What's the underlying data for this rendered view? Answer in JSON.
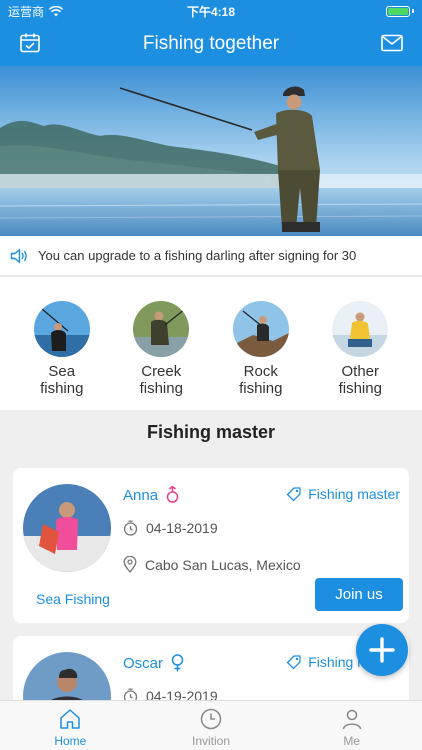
{
  "status": {
    "carrier": "运营商",
    "time": "下午4:18"
  },
  "header": {
    "title": "Fishing together",
    "left_icon": "calendar-icon",
    "right_icon": "mail-icon"
  },
  "notice": {
    "icon": "speaker-icon",
    "text": "You can upgrade to a fishing darling after signing for 30"
  },
  "categories": [
    {
      "label": "Sea fishing"
    },
    {
      "label": "Creek fishing"
    },
    {
      "label": "Rock fishing"
    },
    {
      "label": "Other fishing"
    }
  ],
  "section": {
    "title": "Fishing master"
  },
  "masters": [
    {
      "name": "Anna",
      "gender": "female",
      "tag": "Fishing master",
      "date": "04-18-2019",
      "location": "Cabo San Lucas, Mexico",
      "type": "Sea Fishing",
      "join_label": "Join us"
    },
    {
      "name": "Oscar",
      "gender": "female",
      "tag": "Fishing master",
      "date": "04-19-2019"
    }
  ],
  "tabs": [
    {
      "label": "Home",
      "active": true
    },
    {
      "label": "Invition",
      "active": false
    },
    {
      "label": "Me",
      "active": false
    }
  ],
  "colors": {
    "accent": "#1d8fe1",
    "female": "#e83e8c"
  }
}
